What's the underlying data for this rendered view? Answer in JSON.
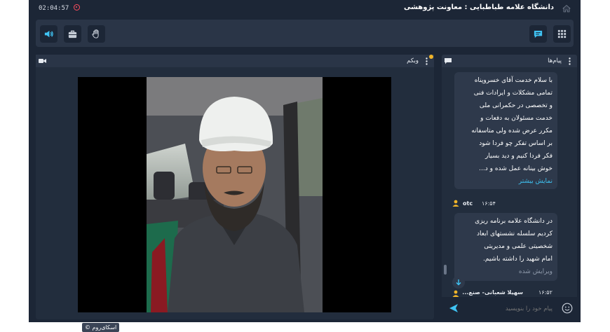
{
  "header": {
    "timer": "02:04:57",
    "title": "دانشگاه علامه طباطبایی : معاونت پژوهشی"
  },
  "toolbar": {
    "left_icons": [
      "speaker-icon",
      "briefcase-icon",
      "hand-icon"
    ],
    "right_icons": [
      "chat-icon",
      "grid-icon"
    ]
  },
  "webcam": {
    "label": "وبکم",
    "watermark": "اسکای‌روم ©"
  },
  "chat": {
    "label": "پیام‌ها",
    "messages": [
      {
        "lines": [
          "با سلام خدمت آقای خسروپناه",
          "تمامی مشکلات و ایرادات فنی",
          "و تخصصی در حکمرانی ملی",
          "خدمت مسئولان به دفعات و",
          "مکرر عرض شده ولی متاسفانه",
          "بر اساس تفکر چو فردا شود",
          "فکر فردا کنیم و دید بسیار",
          "خوش بینانه عمل شده و د..."
        ],
        "show_more": "نمایش بیشتر"
      },
      {
        "sender": "otc",
        "time": "۱۶:۵۴",
        "lines": [
          "در دانشگاه علامه برنامه ریزی",
          "کردیم سلسله نشستهای ابعاد",
          "شخصیتی علمی و مدیریتی",
          "امام شهید را داشته باشیم."
        ],
        "edited": "ویرایش شده"
      },
      {
        "sender": "سهیلا شعبانی- صنع...",
        "time": "۱۶:۵۲"
      }
    ],
    "input_placeholder": "پیام خود را بنویسید"
  },
  "colors": {
    "background": "#1c2636",
    "panel": "#222d3d",
    "bubble": "#2e394b",
    "accent": "#3fc3f3",
    "record": "#ff4d5e",
    "user_icon": "#f0b429"
  }
}
